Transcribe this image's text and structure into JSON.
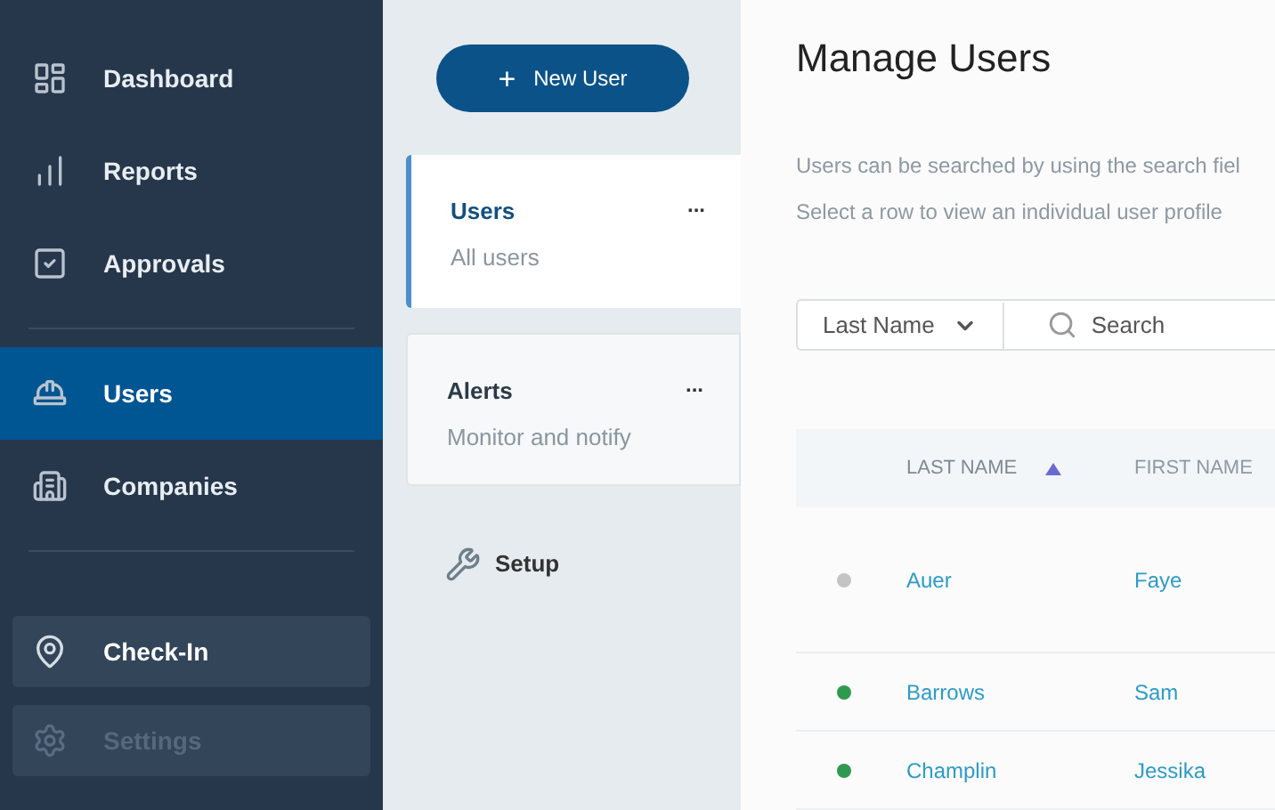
{
  "sidebar": {
    "nav_groups": [
      [
        {
          "label": "Dashboard",
          "kind": "dashboard",
          "selected": false
        },
        {
          "label": "Reports",
          "kind": "reports",
          "selected": false
        },
        {
          "label": "Approvals",
          "kind": "approvals",
          "selected": false
        }
      ],
      [
        {
          "label": "Users",
          "kind": "users",
          "selected": true
        },
        {
          "label": "Companies",
          "kind": "companies",
          "selected": false
        }
      ]
    ],
    "buttons": [
      {
        "label": "Check-In",
        "kind": "checkin",
        "disabled": false
      },
      {
        "label": "Settings",
        "kind": "settings",
        "disabled": true
      }
    ]
  },
  "panel": {
    "new_button": {
      "icon": "+",
      "label": "New User"
    },
    "lists": [
      {
        "title": "Users",
        "subtitle": "All users",
        "menu": "...",
        "selected": true
      },
      {
        "title": "Alerts",
        "subtitle": "Monitor and notify",
        "menu": "...",
        "selected": false
      }
    ],
    "setup": {
      "label": "Setup"
    }
  },
  "main": {
    "title": "Manage Users",
    "descriptions": [
      "Users can be searched by using the search fiel",
      "Select a row to view an individual user profile"
    ],
    "filter": {
      "field": "Last Name",
      "placeholder": "Search"
    },
    "table": {
      "columns": [
        {
          "label": "LAST NAME",
          "sorted": true
        },
        {
          "label": "FIRST NAME",
          "sorted": false
        }
      ],
      "rows": [
        {
          "color": "#c4c4c4",
          "last": "Auer",
          "first": "Faye"
        },
        {
          "color": "#2e9a4f",
          "last": "Barrows",
          "first": "Sam"
        },
        {
          "color": "#2e9a4f",
          "last": "Champlin",
          "first": "Jessika"
        }
      ]
    }
  }
}
